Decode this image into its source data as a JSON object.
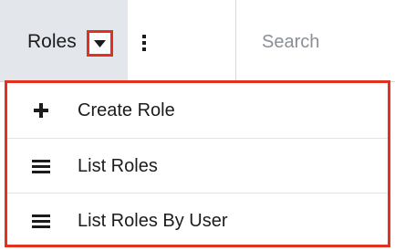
{
  "header": {
    "module_label": "Roles",
    "search_placeholder": "Search",
    "accent_color": "#e2321f",
    "module_tab_bg": "#e3e7ec"
  },
  "menu": {
    "items": [
      {
        "label": "Create Role",
        "icon": "plus-icon"
      },
      {
        "label": "List Roles",
        "icon": "list-icon"
      },
      {
        "label": "List Roles By User",
        "icon": "list-icon"
      }
    ]
  }
}
